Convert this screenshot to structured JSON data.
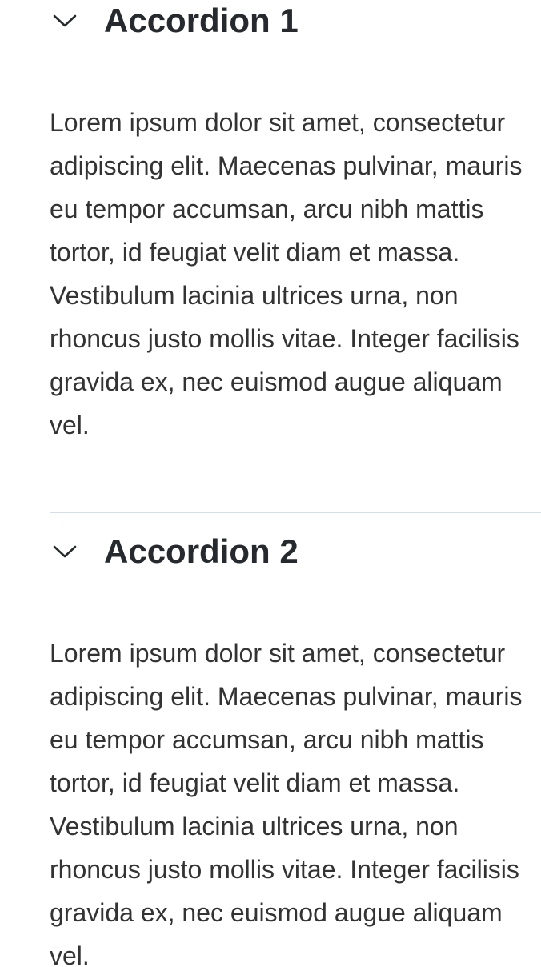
{
  "accordions": [
    {
      "title": "Accordion 1",
      "expanded": true,
      "icon": "chevron-down-icon",
      "body": "Lorem ipsum dolor sit amet, consectetur adipiscing elit. Maecenas pulvinar, mauris eu tempor accumsan, arcu nibh mattis tortor, id feugiat velit diam et massa. Vestibulum lacinia ultrices urna, non rhoncus justo mollis vitae. Integer facilisis gravida ex, nec euismod augue aliquam vel."
    },
    {
      "title": "Accordion 2",
      "expanded": true,
      "icon": "chevron-down-icon",
      "body": "Lorem ipsum dolor sit amet, consectetur adipiscing elit. Maecenas pulvinar, mauris eu tempor accumsan, arcu nibh mattis tortor, id feugiat velit diam et massa. Vestibulum lacinia ultrices urna, non rhoncus justo mollis vitae. Integer facilisis gravida ex, nec euismod augue aliquam vel."
    }
  ],
  "colors": {
    "title": "#262a2e",
    "text": "#333333",
    "divider": "#d7dee5"
  }
}
